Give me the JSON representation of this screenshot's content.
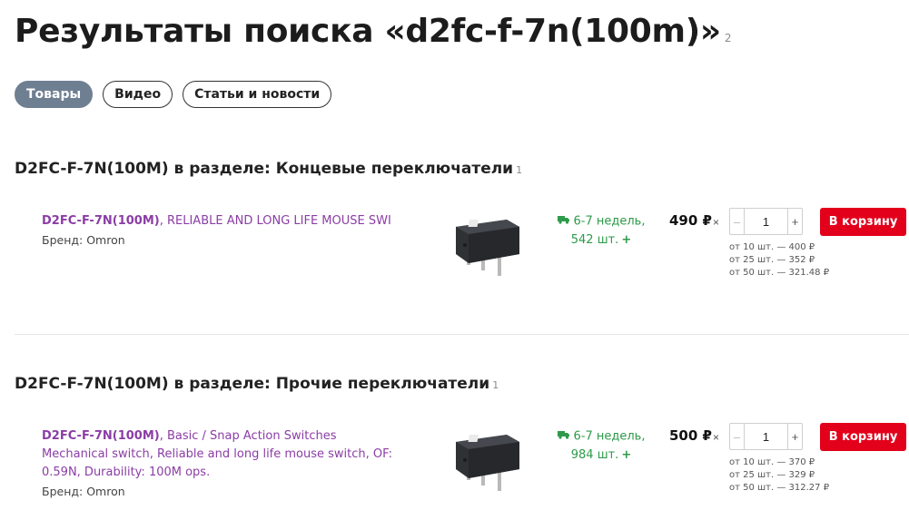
{
  "page": {
    "title": "Результаты поиска «d2fc-f-7n(100m)»",
    "title_count": "2"
  },
  "tabs": [
    {
      "label": "Товары",
      "active": true
    },
    {
      "label": "Видео",
      "active": false
    },
    {
      "label": "Статьи и новости",
      "active": false
    }
  ],
  "sections": [
    {
      "heading": "D2FC-F-7N(100M) в разделе: Концевые переключатели",
      "count": "1",
      "product": {
        "code": "D2FC-F-7N(100M)",
        "desc": ", RELIABLE AND LONG LIFE MOUSE SWI",
        "brand": "Бренд: Omron",
        "image_icon": "microswitch-image",
        "stock_line1": "6-7 недель,",
        "stock_line2": "542 шт.",
        "price": "490 ₽",
        "times": "×",
        "qty": "1",
        "minus": "–",
        "plus": "+",
        "cart_label": "В корзину",
        "tiers": [
          "от 10 шт. — 400 ₽",
          "от 25 шт. — 352 ₽",
          "от 50 шт. — 321.48 ₽"
        ]
      }
    },
    {
      "heading": "D2FC-F-7N(100M) в разделе: Прочие переключатели",
      "count": "1",
      "product": {
        "code": "D2FC-F-7N(100M)",
        "desc": ", Basic / Snap Action Switches Mechanical switch, Reliable and long life mouse switch, OF: 0.59N, Durability: 100M ops.",
        "brand": "Бренд: Omron",
        "image_icon": "microswitch-image",
        "stock_line1": "6-7 недель,",
        "stock_line2": "984 шт.",
        "price": "500 ₽",
        "times": "×",
        "qty": "1",
        "minus": "–",
        "plus": "+",
        "cart_label": "В корзину",
        "tiers": [
          "от 10 шт. — 370 ₽",
          "от 25 шт. — 329 ₽",
          "от 50 шт. — 312.27 ₽"
        ]
      }
    }
  ],
  "colors": {
    "accent_red": "#e3001b",
    "tab_active": "#6f7f92",
    "link_purple": "#8b3da6",
    "stock_green": "#2e9a4a"
  }
}
